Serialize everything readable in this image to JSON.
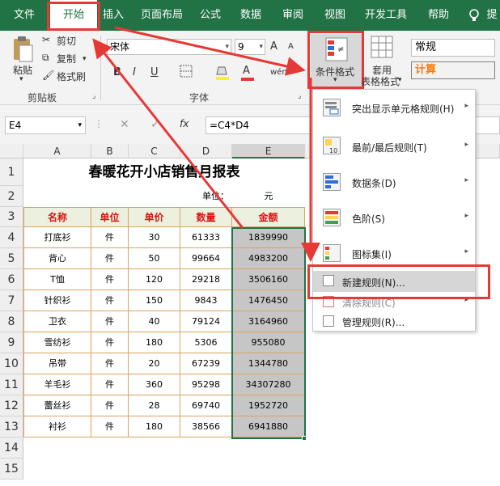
{
  "menubar": {
    "tabs": [
      "文件",
      "开始",
      "插入",
      "页面布局",
      "公式",
      "数据",
      "审阅",
      "视图",
      "开发工具",
      "帮助"
    ],
    "tell_me": "提"
  },
  "ribbon": {
    "clipboard": {
      "paste": "粘贴",
      "cut": "剪切",
      "copy": "复制",
      "format_painter": "格式刷",
      "title": "剪贴板"
    },
    "font": {
      "name": "宋体",
      "size": "9",
      "grow": "A",
      "shrink": "A",
      "bold": "B",
      "italic": "I",
      "underline": "U",
      "font_color": "A",
      "phonetic": "wén",
      "title": "字体"
    },
    "styles": {
      "conditional_format": "条件格式",
      "table_format_1": "套用",
      "table_format_2": "表格格式",
      "normal": "常规",
      "calc": "计算"
    }
  },
  "formula_bar": {
    "cell_ref": "E4",
    "fx": "fx",
    "formula": "=C4*D4"
  },
  "columns": [
    "A",
    "B",
    "C",
    "D",
    "E"
  ],
  "rows": [
    "1",
    "2",
    "3",
    "4",
    "5",
    "6",
    "7",
    "8",
    "9",
    "10",
    "11",
    "12",
    "13",
    "14",
    "15"
  ],
  "sheet": {
    "title": "春暖花开小店销售月报表",
    "unit_label": "单位：",
    "unit_value": "元",
    "headers": [
      "名称",
      "单位",
      "单价",
      "数量",
      "金额"
    ],
    "data": [
      [
        "打底衫",
        "件",
        "30",
        "61333",
        "1839990"
      ],
      [
        "背心",
        "件",
        "50",
        "99664",
        "4983200"
      ],
      [
        "T恤",
        "件",
        "120",
        "29218",
        "3506160"
      ],
      [
        "针织衫",
        "件",
        "150",
        "9843",
        "1476450"
      ],
      [
        "卫衣",
        "件",
        "40",
        "79124",
        "3164960"
      ],
      [
        "雪纺衫",
        "件",
        "180",
        "5306",
        "955080"
      ],
      [
        "吊带",
        "件",
        "20",
        "67239",
        "1344780"
      ],
      [
        "羊毛衫",
        "件",
        "360",
        "95298",
        "34307280"
      ],
      [
        "蕾丝衫",
        "件",
        "28",
        "69740",
        "1952720"
      ],
      [
        "衬衫",
        "件",
        "180",
        "38566",
        "6941880"
      ]
    ]
  },
  "cf_menu": {
    "items": [
      {
        "label": "突出显示单元格规则(H)",
        "arrow": "▸"
      },
      {
        "label": "最前/最后规则(T)",
        "arrow": "▸"
      },
      {
        "label": "数据条(D)",
        "arrow": "▸"
      },
      {
        "label": "色阶(S)",
        "arrow": "▸"
      },
      {
        "label": "图标集(I)",
        "arrow": "▸"
      },
      {
        "label": "新建规则(N)...",
        "arrow": ""
      },
      {
        "label": "清除规则(C)",
        "arrow": "▸"
      },
      {
        "label": "管理规则(R)...",
        "arrow": ""
      }
    ]
  },
  "colors": {
    "ribbon_green": "#217346",
    "highlight_red": "#e53935",
    "header_fill": "#ebf1de",
    "selection_grey": "#c6c6c6"
  }
}
